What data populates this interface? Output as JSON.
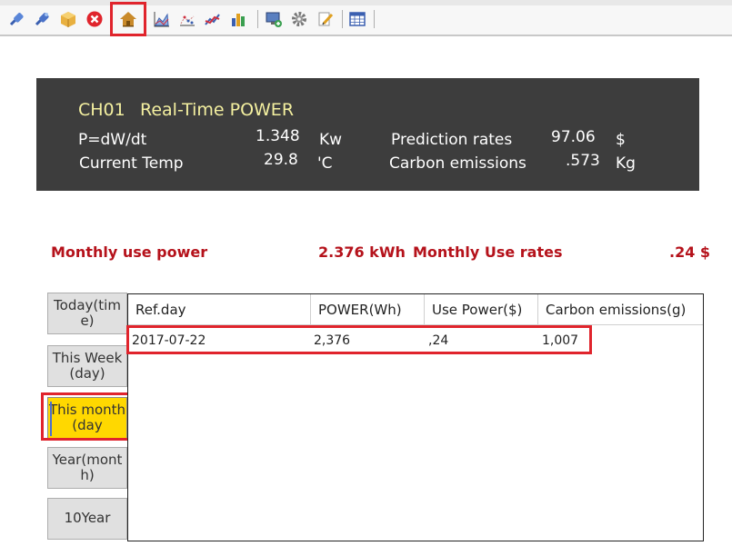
{
  "toolbar": {
    "icons": [
      "pin-blue-icon",
      "pin-blue-2-icon",
      "box-icon",
      "close-red-icon",
      "home-icon",
      "chart-area-icon",
      "chart-scatter-icon",
      "chart-line-icon",
      "chart-bar-icon",
      "monitor-icon",
      "gear-icon",
      "edit-icon",
      "grid-icon"
    ]
  },
  "panel": {
    "title_channel": "CH01",
    "title_text": "Real-Time POWER",
    "power_label": "P=dW/dt",
    "power_value": "1.348",
    "power_unit": "Kw",
    "temp_label": "Current Temp",
    "temp_value": "29.8",
    "temp_unit": "'C",
    "prediction_label": "Prediction rates",
    "prediction_value": "97.06",
    "prediction_unit": "$",
    "carbon_label": "Carbon emissions",
    "carbon_value": ".573",
    "carbon_unit": "Kg"
  },
  "summary": {
    "monthly_power_label": "Monthly use power",
    "monthly_power_value": "2.376 kWh",
    "monthly_rates_label": "Monthly Use rates",
    "monthly_rates_value": ".24 $"
  },
  "side_buttons": [
    {
      "label": "Today(time)"
    },
    {
      "label": "This Week(day)"
    },
    {
      "label": "This month(day"
    },
    {
      "label": "Year(month)"
    },
    {
      "label": "10Year"
    }
  ],
  "table": {
    "columns": [
      "Ref.day",
      "POWER(Wh)",
      "Use Power($)",
      "Carbon emissions(g)"
    ],
    "rows": [
      [
        "2017-07-22",
        "2,376",
        ",24",
        "1,007"
      ]
    ]
  },
  "colors": {
    "panel_bg": "#3d3d3d",
    "panel_title": "#f4f0a0",
    "summary_red": "#b5121b",
    "active_tab": "#ffd800",
    "highlight_red": "#e0242c"
  }
}
